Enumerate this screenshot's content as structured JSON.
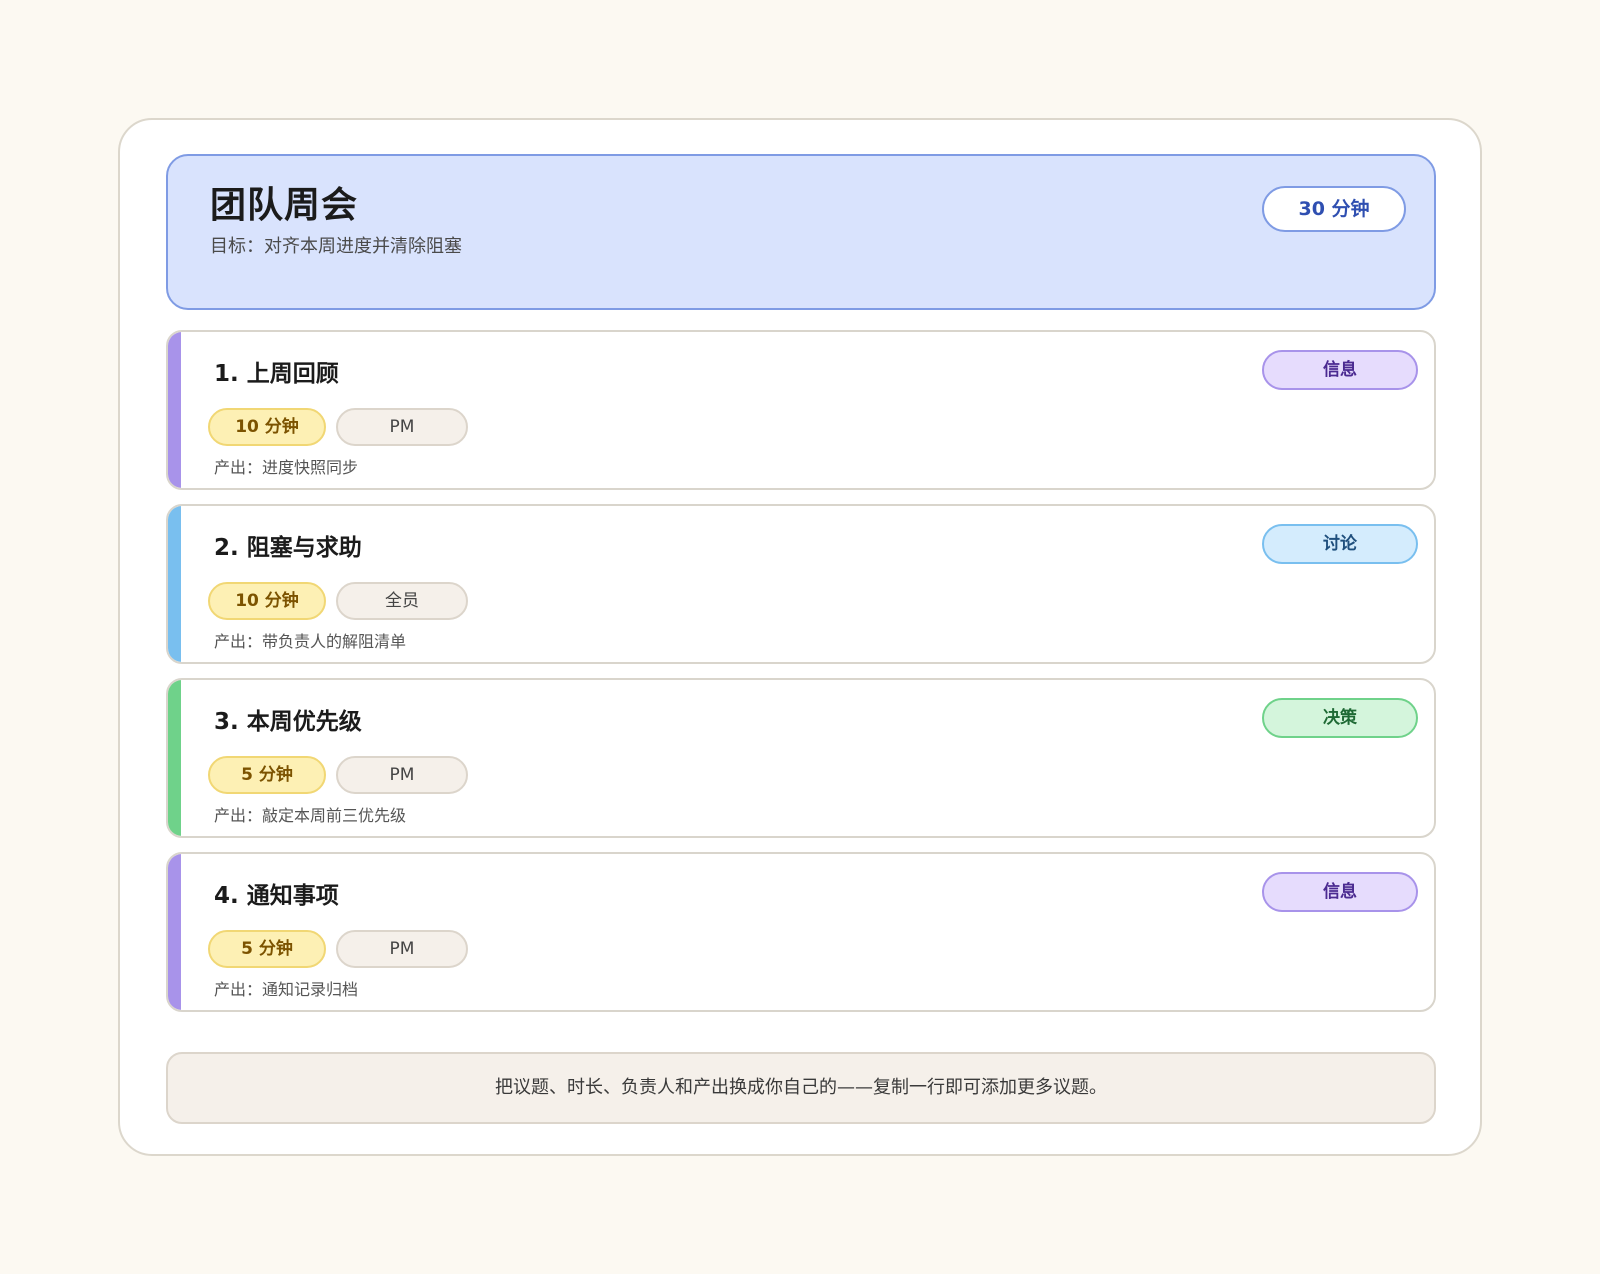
{
  "header": {
    "title": "团队周会",
    "goal": "目标：对齐本周进度并清除阻塞",
    "duration": "30 分钟"
  },
  "colors": {
    "info": "#a893ea",
    "discuss": "#79bfef",
    "decide": "#6fd28a"
  },
  "items": [
    {
      "title": "1. 上周回顾",
      "duration": "10 分钟",
      "owner": "PM",
      "output": "产出：进度快照同步",
      "type": "信息"
    },
    {
      "title": "2. 阻塞与求助",
      "duration": "10 分钟",
      "owner": "全员",
      "output": "产出：带负责人的解阻清单",
      "type": "讨论"
    },
    {
      "title": "3. 本周优先级",
      "duration": "5 分钟",
      "owner": "PM",
      "output": "产出：敲定本周前三优先级",
      "type": "决策"
    },
    {
      "title": "4. 通知事项",
      "duration": "5 分钟",
      "owner": "PM",
      "output": "产出：通知记录归档",
      "type": "信息"
    }
  ],
  "footer": {
    "note": "把议题、时长、负责人和产出换成你自己的——复制一行即可添加更多议题。"
  }
}
